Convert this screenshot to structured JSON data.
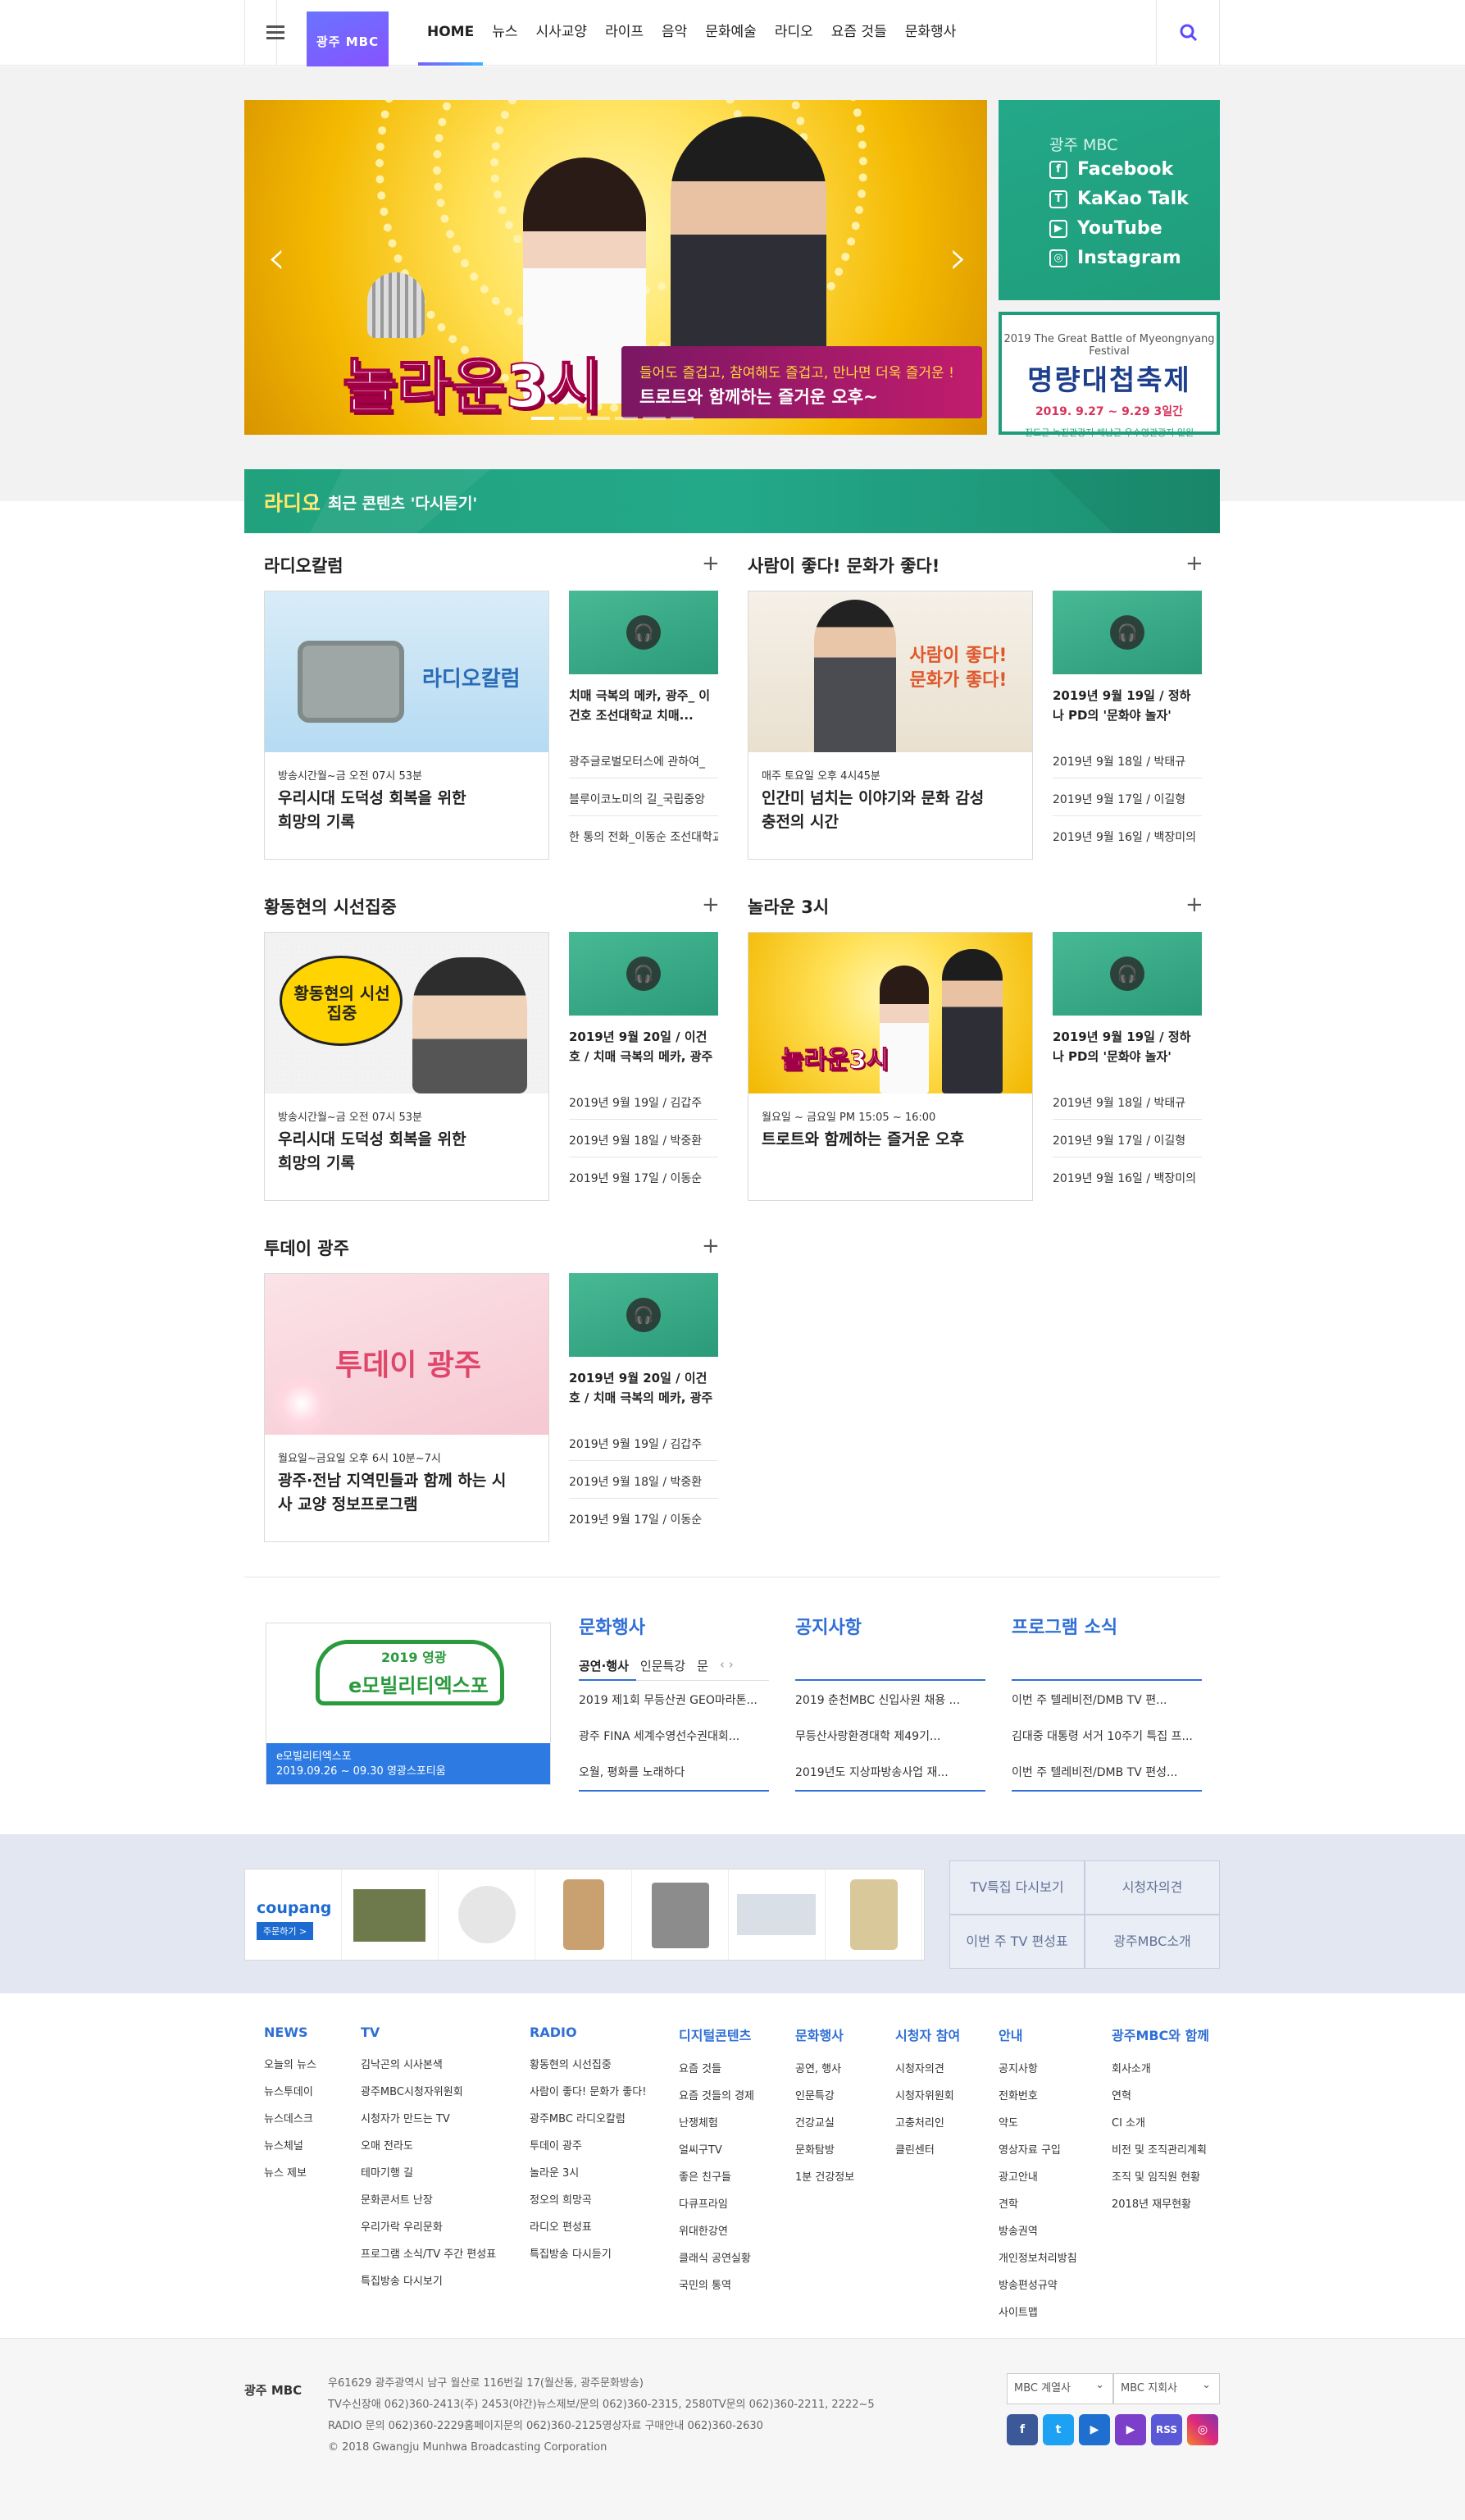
{
  "header": {
    "logo": "광주 MBC",
    "nav": [
      "HOME",
      "뉴스",
      "시사교양",
      "라이프",
      "음악",
      "문화예술",
      "라디오",
      "요즘 것들",
      "문화행사"
    ]
  },
  "hero": {
    "title": "놀라운3시",
    "sub1": "들어도 즐겁고, 참여해도 즐겁고, 만나면 더욱 즐거운 !",
    "sub2": "트로트와 함께하는 즐거운 오후~",
    "prev": "‹",
    "next": "›"
  },
  "social": {
    "title": "광주 MBC",
    "items": [
      "Facebook",
      "KaKao Talk",
      "YouTube",
      "Instagram"
    ]
  },
  "festival": {
    "line1": "2019 The Great Battle of Myeongnyang Festival",
    "line2": "명량대첩축제",
    "line3": "2019. 9.27 ~ 9.29 3일간",
    "line4": "진도군 녹진관광지·해남군 우수영관광지 일원"
  },
  "radio": {
    "label": "라디오",
    "subtitle": "최근 콘텐츠 '다시듣기'"
  },
  "sections": [
    {
      "title": "라디오칼럼",
      "img_text": "라디오칼럼",
      "meta": "방송시간월~금 오전 07시 53분",
      "main_title": "우리시대 도덕성 회복을 위한 희망의 기록",
      "thumb_title": "치매 극복의 메카, 광주_ 이건호 조선대학교 치매...",
      "list": [
        "광주글로벌모터스에 관하여_",
        "블루이코노미의 길_국립중앙",
        "한 통의 전화_이동순 조선대학교"
      ]
    },
    {
      "title": "사람이 좋다! 문화가 좋다!",
      "img_text": "사람이 좋다! 문화가 좋다!",
      "meta": "매주 토요일 오후 4시45분",
      "main_title": "인간미 넘치는 이야기와 문화 감성 충전의 시간",
      "thumb_title": "2019년 9월 19일 / 정하나 PD의 '문화야 놀자'",
      "list": [
        "2019년 9월 18일 / 박태규",
        "2019년 9월 17일 / 이길형",
        "2019년 9월 16일 / 백장미의"
      ]
    },
    {
      "title": "황동현의 시선집중",
      "img_text": "황동현의 시선집중",
      "meta": "방송시간월~금 오전 07시 53분",
      "main_title": "우리시대 도덕성 회복을 위한 희망의 기록",
      "thumb_title": "2019년 9월 20일 / 이건호 / 치매 극복의 메카, 광주",
      "list": [
        "2019년 9월 19일 / 김갑주",
        "2019년 9월 18일 / 박중환",
        "2019년 9월 17일 / 이동순"
      ]
    },
    {
      "title": "놀라운 3시",
      "img_text": "놀라운3시",
      "meta": "월요일 ~ 금요일 PM 15:05 ~ 16:00",
      "main_title": "트로트와 함께하는 즐거운 오후",
      "thumb_title": "2019년 9월 19일 / 정하나 PD의 '문화야 놀자'",
      "list": [
        "2019년 9월 18일 / 박태규",
        "2019년 9월 17일 / 이길형",
        "2019년 9월 16일 / 백장미의"
      ]
    },
    {
      "title": "투데이 광주",
      "img_text": "투데이 광주",
      "meta": "월요일~금요일 오후 6시 10분~7시",
      "main_title": "광주·전남 지역민들과 함께 하는 시사 교양 정보프로그램",
      "thumb_title": "2019년 9월 20일 / 이건호 / 치매 극복의 메카, 광주",
      "list": [
        "2019년 9월 19일 / 김갑주",
        "2019년 9월 18일 / 박중환",
        "2019년 9월 17일 / 이동순"
      ]
    }
  ],
  "expo": {
    "badge": "2019 영광",
    "name": "e모빌리티엑스포",
    "cap1": "e모빌리티엑스포",
    "cap2": "2019.09.26 ~ 09.30 영광스포티움"
  },
  "events": {
    "title": "문화행사",
    "tabs": [
      "공연·행사",
      "인문특강",
      "문"
    ],
    "items": [
      "2019 제1회 무등산권 GEO마라톤...",
      "광주 FINA 세계수영선수권대회...",
      "오월, 평화를 노래하다"
    ]
  },
  "notice": {
    "title": "공지사항",
    "items": [
      "2019 춘천MBC 신입사원 채용 ...",
      "무등산사랑환경대학 제49기...",
      "2019년도 지상파방송사업 재..."
    ]
  },
  "program": {
    "title": "프로그램 소식",
    "items": [
      "이번 주 텔레비전/DMB TV 편...",
      "김대중 대통령 서거 10주기 특집 프...",
      "이번 주 텔레비전/DMB TV 편성..."
    ]
  },
  "coupang": {
    "brand": "coupang",
    "cta": "주문하기 >"
  },
  "quick": [
    "TV특집 다시보기",
    "시청자의견",
    "이번 주 TV 편성표",
    "광주MBC소개"
  ],
  "sitemap": [
    {
      "h": "NEWS",
      "items": [
        "오늘의 뉴스",
        "뉴스투데이",
        "뉴스데스크",
        "뉴스체널",
        "뉴스 제보"
      ]
    },
    {
      "h": "TV",
      "items": [
        "김낙곤의 시사본색",
        "광주MBC시청자위원회",
        "시청자가 만드는 TV",
        "오매 전라도",
        "테마기행 길",
        "문화콘서트 난장",
        "우리가락 우리문화",
        "프로그램 소식/TV 주간 편성표",
        "특집방송 다시보기"
      ]
    },
    {
      "h": "RADIO",
      "items": [
        "황동현의 시선집중",
        "사람이 좋다! 문화가 좋다!",
        "광주MBC 라디오칼럼",
        "투데이 광주",
        "놀라운 3시",
        "정오의 희망곡",
        "라디오 편성표",
        "특집방송 다시듣기"
      ]
    },
    {
      "h": "디지털콘텐츠",
      "items": [
        "요즘 것들",
        "요즘 것들의 경제",
        "난쟁체험",
        "얼씨구TV",
        "좋은 친구들",
        "다큐프라임",
        "위대한강연",
        "클래식 공연실황",
        "국민의 통역"
      ]
    },
    {
      "h": "문화행사",
      "items": [
        "공연, 행사",
        "인문특강",
        "건강교실",
        "문화탐방",
        "1분 건강정보"
      ]
    },
    {
      "h": "시청자 참여",
      "items": [
        "시청자의견",
        "시청자위원회",
        "고충처리인",
        "클린센터"
      ]
    },
    {
      "h": "안내",
      "items": [
        "공지사항",
        "전화번호",
        "약도",
        "영상자료 구입",
        "광고안내",
        "견학",
        "방송권역",
        "개인정보처리방침",
        "방송편성규약",
        "사이트맵"
      ]
    },
    {
      "h": "광주MBC와 함께",
      "items": [
        "회사소개",
        "연혁",
        "CI 소개",
        "비전 및 조직관리계획",
        "조직 및 임직원 현황",
        "2018년 재무현황"
      ]
    }
  ],
  "footer": {
    "logo": "광주 MBC",
    "lines": [
      "우61629 광주광역시 남구 월산로 116번길 17(월산동, 광주문화방송)",
      "TV수신장애 062)360-2413(주) 2453(야간)뉴스제보/문의 062)360-2315, 2580TV문의 062)360-2211, 2222~5",
      "RADIO 문의 062)360-2229홈페이지문의 062)360-2125영상자료 구매안내 062)360-2630",
      "© 2018 Gwangju Munhwa Broadcasting Corporation"
    ],
    "select1": "MBC 계열사",
    "select2": "MBC 지회사",
    "sns": [
      "f",
      "t",
      "▶",
      "▶",
      "RSS",
      "◎"
    ]
  },
  "colors": {
    "accent": "#23a889",
    "blue": "#2f6fd6",
    "purple": "#7b5cff"
  }
}
